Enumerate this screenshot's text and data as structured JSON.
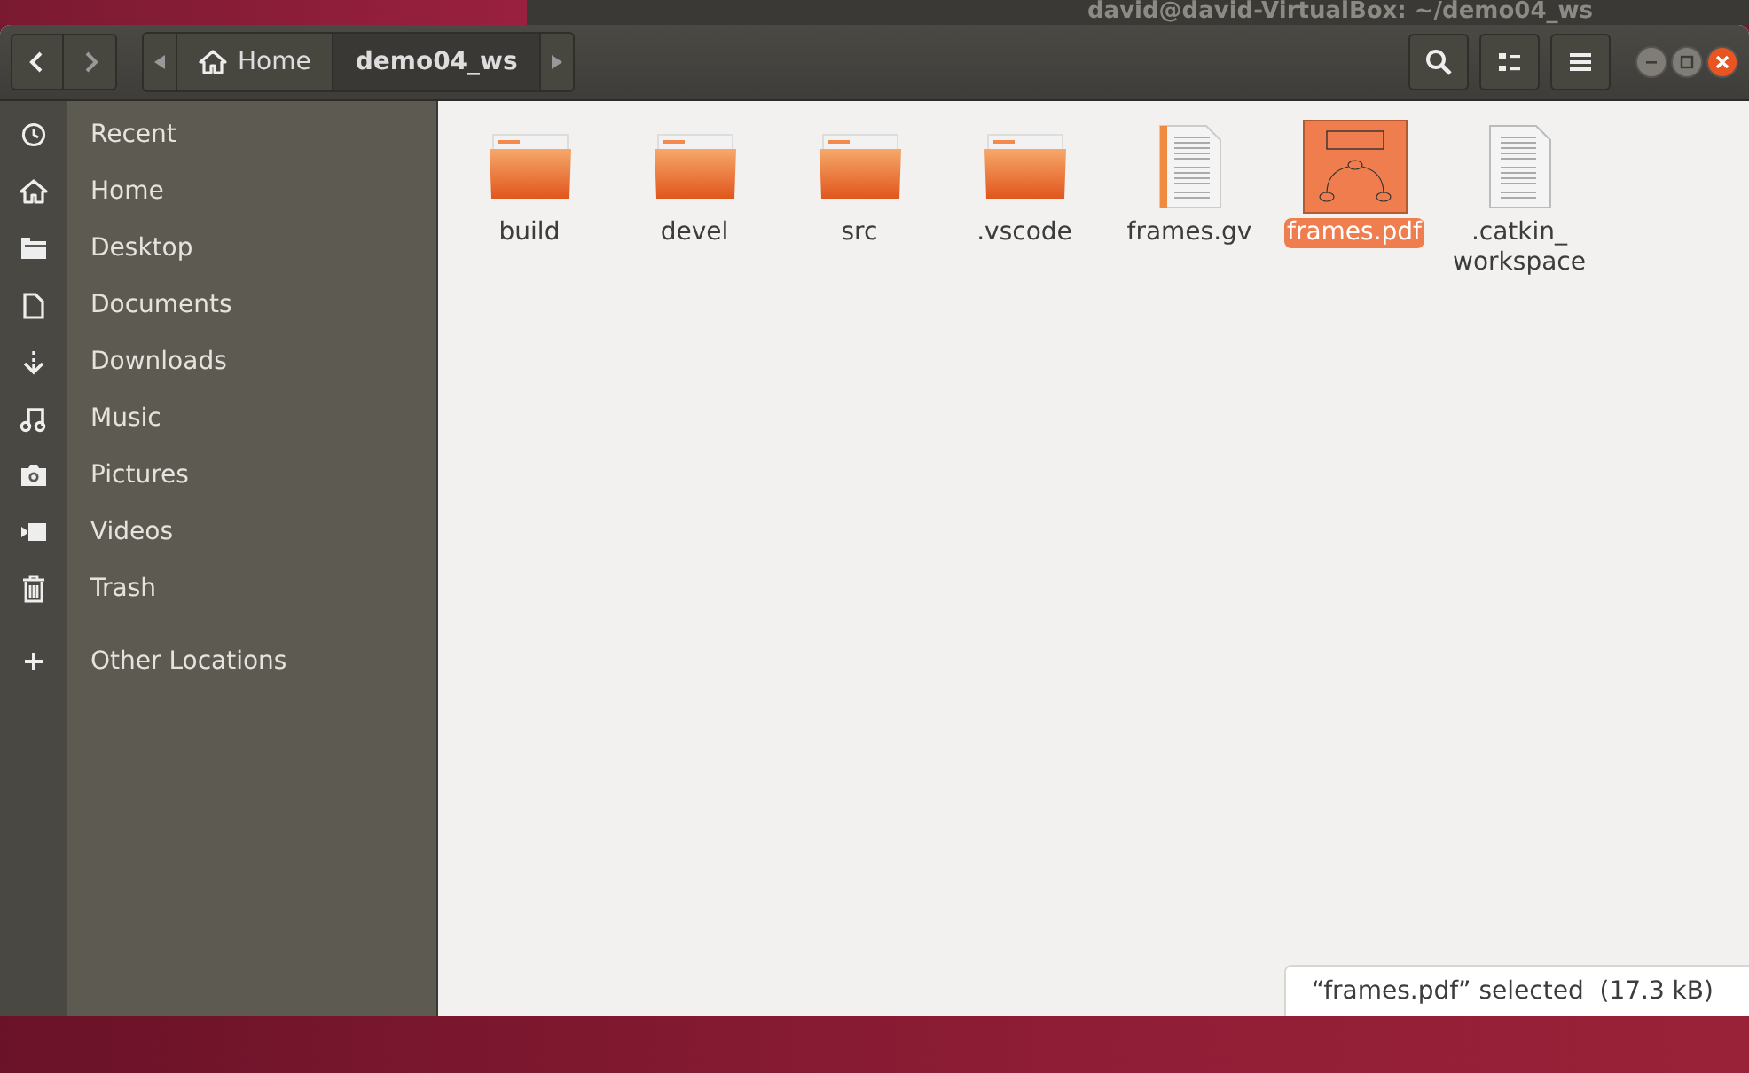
{
  "background_window": {
    "title": "david@david-VirtualBox: ~/demo04_ws"
  },
  "path_bar": {
    "segments": [
      {
        "label": "Home",
        "kind": "home",
        "selected": false
      },
      {
        "label": "demo04_ws",
        "kind": "folder",
        "selected": true
      }
    ]
  },
  "sidebar": {
    "items": [
      {
        "label": "Recent",
        "kind": "recent"
      },
      {
        "label": "Home",
        "kind": "home"
      },
      {
        "label": "Desktop",
        "kind": "desktop"
      },
      {
        "label": "Documents",
        "kind": "documents"
      },
      {
        "label": "Downloads",
        "kind": "downloads"
      },
      {
        "label": "Music",
        "kind": "music"
      },
      {
        "label": "Pictures",
        "kind": "pictures"
      },
      {
        "label": "Videos",
        "kind": "videos"
      },
      {
        "label": "Trash",
        "kind": "trash"
      },
      {
        "label": "Other Locations",
        "kind": "other"
      }
    ]
  },
  "files": [
    {
      "name": "build",
      "kind": "folder",
      "selected": false
    },
    {
      "name": "devel",
      "kind": "folder",
      "selected": false
    },
    {
      "name": "src",
      "kind": "folder",
      "selected": false
    },
    {
      "name": ".vscode",
      "kind": "folder",
      "selected": false
    },
    {
      "name": "frames.gv",
      "kind": "text",
      "selected": false
    },
    {
      "name": "frames.pdf",
      "kind": "pdf",
      "selected": true
    },
    {
      "name": ".catkin_ workspace",
      "kind": "document",
      "selected": false
    }
  ],
  "status": {
    "text": "“frames.pdf” selected  (17.3 kB)"
  }
}
